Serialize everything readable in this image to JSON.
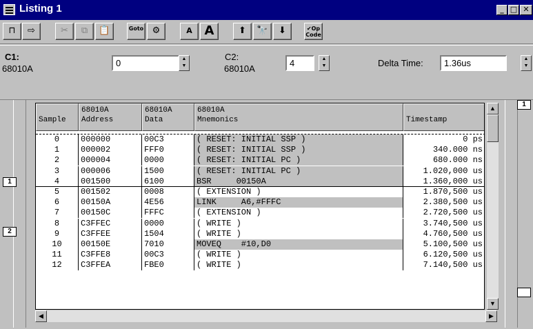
{
  "window": {
    "title": "Listing 1"
  },
  "toolbar": {
    "buttons": [
      {
        "name": "connect-icon-button",
        "glyph": "⊓",
        "disabled": false
      },
      {
        "name": "insert-icon-button",
        "glyph": "⇨",
        "disabled": false
      },
      {
        "name": "cut-button",
        "glyph": "✂",
        "disabled": true
      },
      {
        "name": "copy-button",
        "glyph": "⧉",
        "disabled": true
      },
      {
        "name": "paste-button",
        "glyph": "📋",
        "disabled": false
      },
      {
        "name": "goto-button",
        "glyph": "Goto",
        "disabled": false
      },
      {
        "name": "properties-button",
        "glyph": "⚙",
        "disabled": false
      },
      {
        "name": "font-smaller-button",
        "glyph": "A",
        "disabled": false
      },
      {
        "name": "font-larger-button",
        "glyph": "A",
        "disabled": false
      },
      {
        "name": "search-up-button",
        "glyph": "⬆",
        "disabled": false
      },
      {
        "name": "find-button",
        "glyph": "🔭",
        "disabled": false
      },
      {
        "name": "search-down-button",
        "glyph": "⬇",
        "disabled": false
      },
      {
        "name": "opcode-button",
        "glyph": "✔Op Code",
        "disabled": false
      }
    ]
  },
  "cursors": {
    "c1_label": "C1:",
    "c1_source": "68010A",
    "c1_value": "0",
    "c2_label": "C2:",
    "c2_source": "68010A",
    "c2_value": "4",
    "delta_label": "Delta Time:",
    "delta_value": "1.36us"
  },
  "markers": {
    "m1": "1",
    "m2": "2",
    "right_top": "1"
  },
  "table": {
    "headers": [
      {
        "line1": "",
        "line2": "Sample"
      },
      {
        "line1": "68010A",
        "line2": "Address"
      },
      {
        "line1": "68010A",
        "line2": "Data"
      },
      {
        "line1": "68010A",
        "line2": "Mnemonics"
      },
      {
        "line1": "",
        "line2": "Timestamp"
      }
    ],
    "rows": [
      {
        "sample": "0",
        "address": "000000",
        "data": "00C3",
        "mnemonic": "( RESET: INITIAL SSP )",
        "timestamp": "0 ps",
        "shaded": true
      },
      {
        "sample": "1",
        "address": "000002",
        "data": "FFF0",
        "mnemonic": "( RESET: INITIAL SSP )",
        "timestamp": "340.000 ns",
        "shaded": true
      },
      {
        "sample": "2",
        "address": "000004",
        "data": "0000",
        "mnemonic": "( RESET: INITIAL PC )",
        "timestamp": "680.000 ns",
        "shaded": true
      },
      {
        "sample": "3",
        "address": "000006",
        "data": "1500",
        "mnemonic": "( RESET: INITIAL PC )",
        "timestamp": "1.020,000 us",
        "shaded": true
      },
      {
        "sample": "4",
        "address": "001500",
        "data": "6100",
        "mnemonic": "BSR     00150A",
        "timestamp": "1.360,000 us",
        "shaded": true
      },
      {
        "sample": "5",
        "address": "001502",
        "data": "0008",
        "mnemonic": "( EXTENSION )",
        "timestamp": "1.870,500 us",
        "shaded": false
      },
      {
        "sample": "6",
        "address": "00150A",
        "data": "4E56",
        "mnemonic": "LINK     A6,#FFFC",
        "timestamp": "2.380,500 us",
        "shaded": true
      },
      {
        "sample": "7",
        "address": "00150C",
        "data": "FFFC",
        "mnemonic": "( EXTENSION )",
        "timestamp": "2.720,500 us",
        "shaded": false
      },
      {
        "sample": "8",
        "address": "C3FFEC",
        "data": "0000",
        "mnemonic": "( WRITE )",
        "timestamp": "3.740,500 us",
        "shaded": false
      },
      {
        "sample": "9",
        "address": "C3FFEE",
        "data": "1504",
        "mnemonic": "( WRITE )",
        "timestamp": "4.760,500 us",
        "shaded": false
      },
      {
        "sample": "10",
        "address": "00150E",
        "data": "7010",
        "mnemonic": "MOVEQ    #10,D0",
        "timestamp": "5.100,500 us",
        "shaded": true
      },
      {
        "sample": "11",
        "address": "C3FFE8",
        "data": "00C3",
        "mnemonic": "( WRITE )",
        "timestamp": "6.120,500 us",
        "shaded": false
      },
      {
        "sample": "12",
        "address": "C3FFEA",
        "data": "FBE0",
        "mnemonic": "( WRITE )",
        "timestamp": "7.140,500 us",
        "shaded": false
      }
    ]
  }
}
